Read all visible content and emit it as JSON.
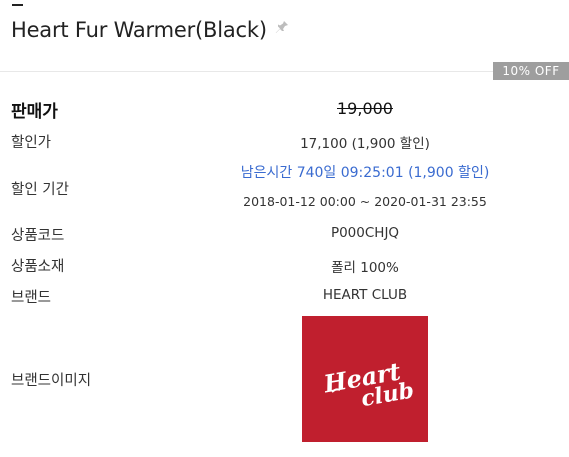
{
  "product": {
    "title": "Heart Fur Warmer(Black)",
    "pin_icon": "pin-icon"
  },
  "badge": {
    "discount": "10% OFF"
  },
  "rows": {
    "sale_price": {
      "label": "판매가",
      "value": "19,000"
    },
    "discount_price": {
      "label": "할인가",
      "value": "17,100 (1,900 할인)"
    },
    "discount_period": {
      "label": "할인 기간",
      "remaining": "남은시간 740일 09:25:01 (1,900 할인)",
      "range": "2018-01-12 00:00 ~ 2020-01-31 23:55"
    },
    "product_code": {
      "label": "상품코드",
      "value": "P000CHJQ"
    },
    "material": {
      "label": "상품소재",
      "value": "폴리 100%"
    },
    "brand": {
      "label": "브랜드",
      "value": "HEART CLUB"
    },
    "brand_image": {
      "label": "브랜드이미지",
      "logo_text_1": "Heart",
      "logo_text_2": "club"
    }
  },
  "colors": {
    "logo_bg": "#c01f2e",
    "accent_blue": "#3a6bd0",
    "badge_bg": "#9e9e9e"
  }
}
